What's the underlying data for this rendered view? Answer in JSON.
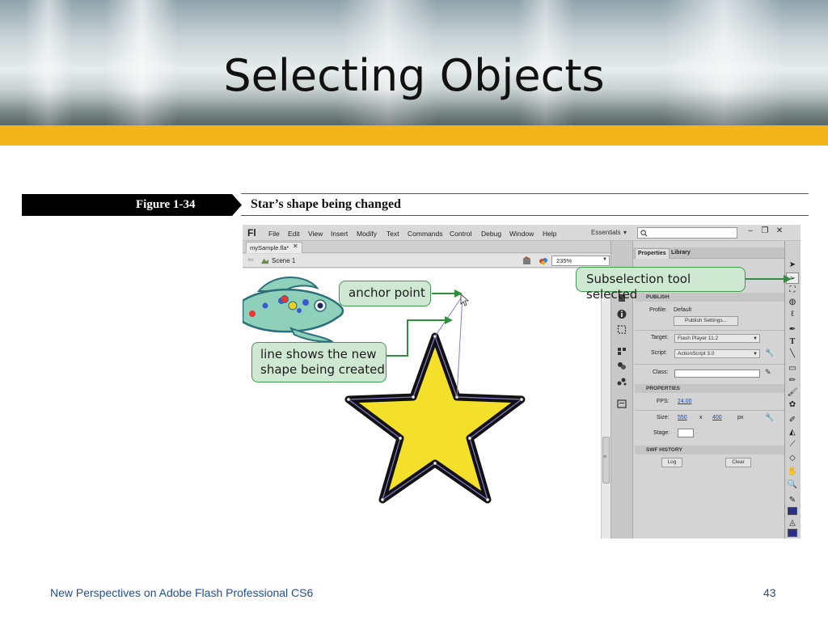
{
  "slide": {
    "title": "Selecting Objects",
    "footer_text": "New Perspectives on Adobe Flash Professional CS6",
    "page_number": "43"
  },
  "figure": {
    "number": "Figure 1-34",
    "caption": "Star’s shape being changed"
  },
  "app": {
    "logo": "Fl",
    "menu": [
      "File",
      "Edit",
      "View",
      "Insert",
      "Modify",
      "Text",
      "Commands",
      "Control",
      "Debug",
      "Window",
      "Help"
    ],
    "workspace": "Essentials",
    "window_buttons": [
      "–",
      "❐",
      "✕"
    ],
    "document_tab": "mySample.fla*",
    "scene": "Scene 1",
    "zoom": "235%"
  },
  "properties_panel": {
    "tabs": [
      "Properties",
      "Library"
    ],
    "publish": {
      "heading": "PUBLISH",
      "profile_label": "Profile:",
      "profile_value": "Default",
      "publish_settings_button": "Publish Settings...",
      "target_label": "Target:",
      "target_value": "Flash Player 11.2",
      "script_label": "Script:",
      "script_value": "ActionScript 3.0",
      "class_label": "Class:"
    },
    "properties": {
      "heading": "PROPERTIES",
      "fps_label": "FPS:",
      "fps_value": "24.00",
      "size_label": "Size:",
      "width": "550",
      "times": "x",
      "height": "400",
      "unit": "px",
      "stage_label": "Stage:"
    },
    "swf_history": {
      "heading": "SWF HISTORY",
      "log_button": "Log",
      "clear_button": "Clear"
    }
  },
  "callouts": {
    "anchor_point": "anchor point",
    "line_shows_1": "line shows the new",
    "line_shows_2": "shape being created",
    "subselection": "Subselection tool selected"
  },
  "colors": {
    "gold_bar": "#f2b41a",
    "callout_fill": "#cfe8d2",
    "callout_border": "#3f9a4d",
    "star_fill": "#f4e02a",
    "fish_fill": "#8fd0bb",
    "footer_text": "#1f4e96"
  },
  "icons": {
    "tools": [
      "selection-arrow-icon",
      "subselection-arrow-icon",
      "free-transform-icon",
      "3d-rotation-icon",
      "lasso-icon",
      "pen-icon",
      "text-icon",
      "line-icon",
      "rectangle-icon",
      "pencil-icon",
      "brush-icon",
      "deco-icon",
      "bone-icon",
      "paint-bucket-icon",
      "eyedropper-icon",
      "eraser-icon",
      "hand-icon",
      "zoom-icon",
      "stroke-color-icon",
      "fill-color-icon"
    ]
  }
}
